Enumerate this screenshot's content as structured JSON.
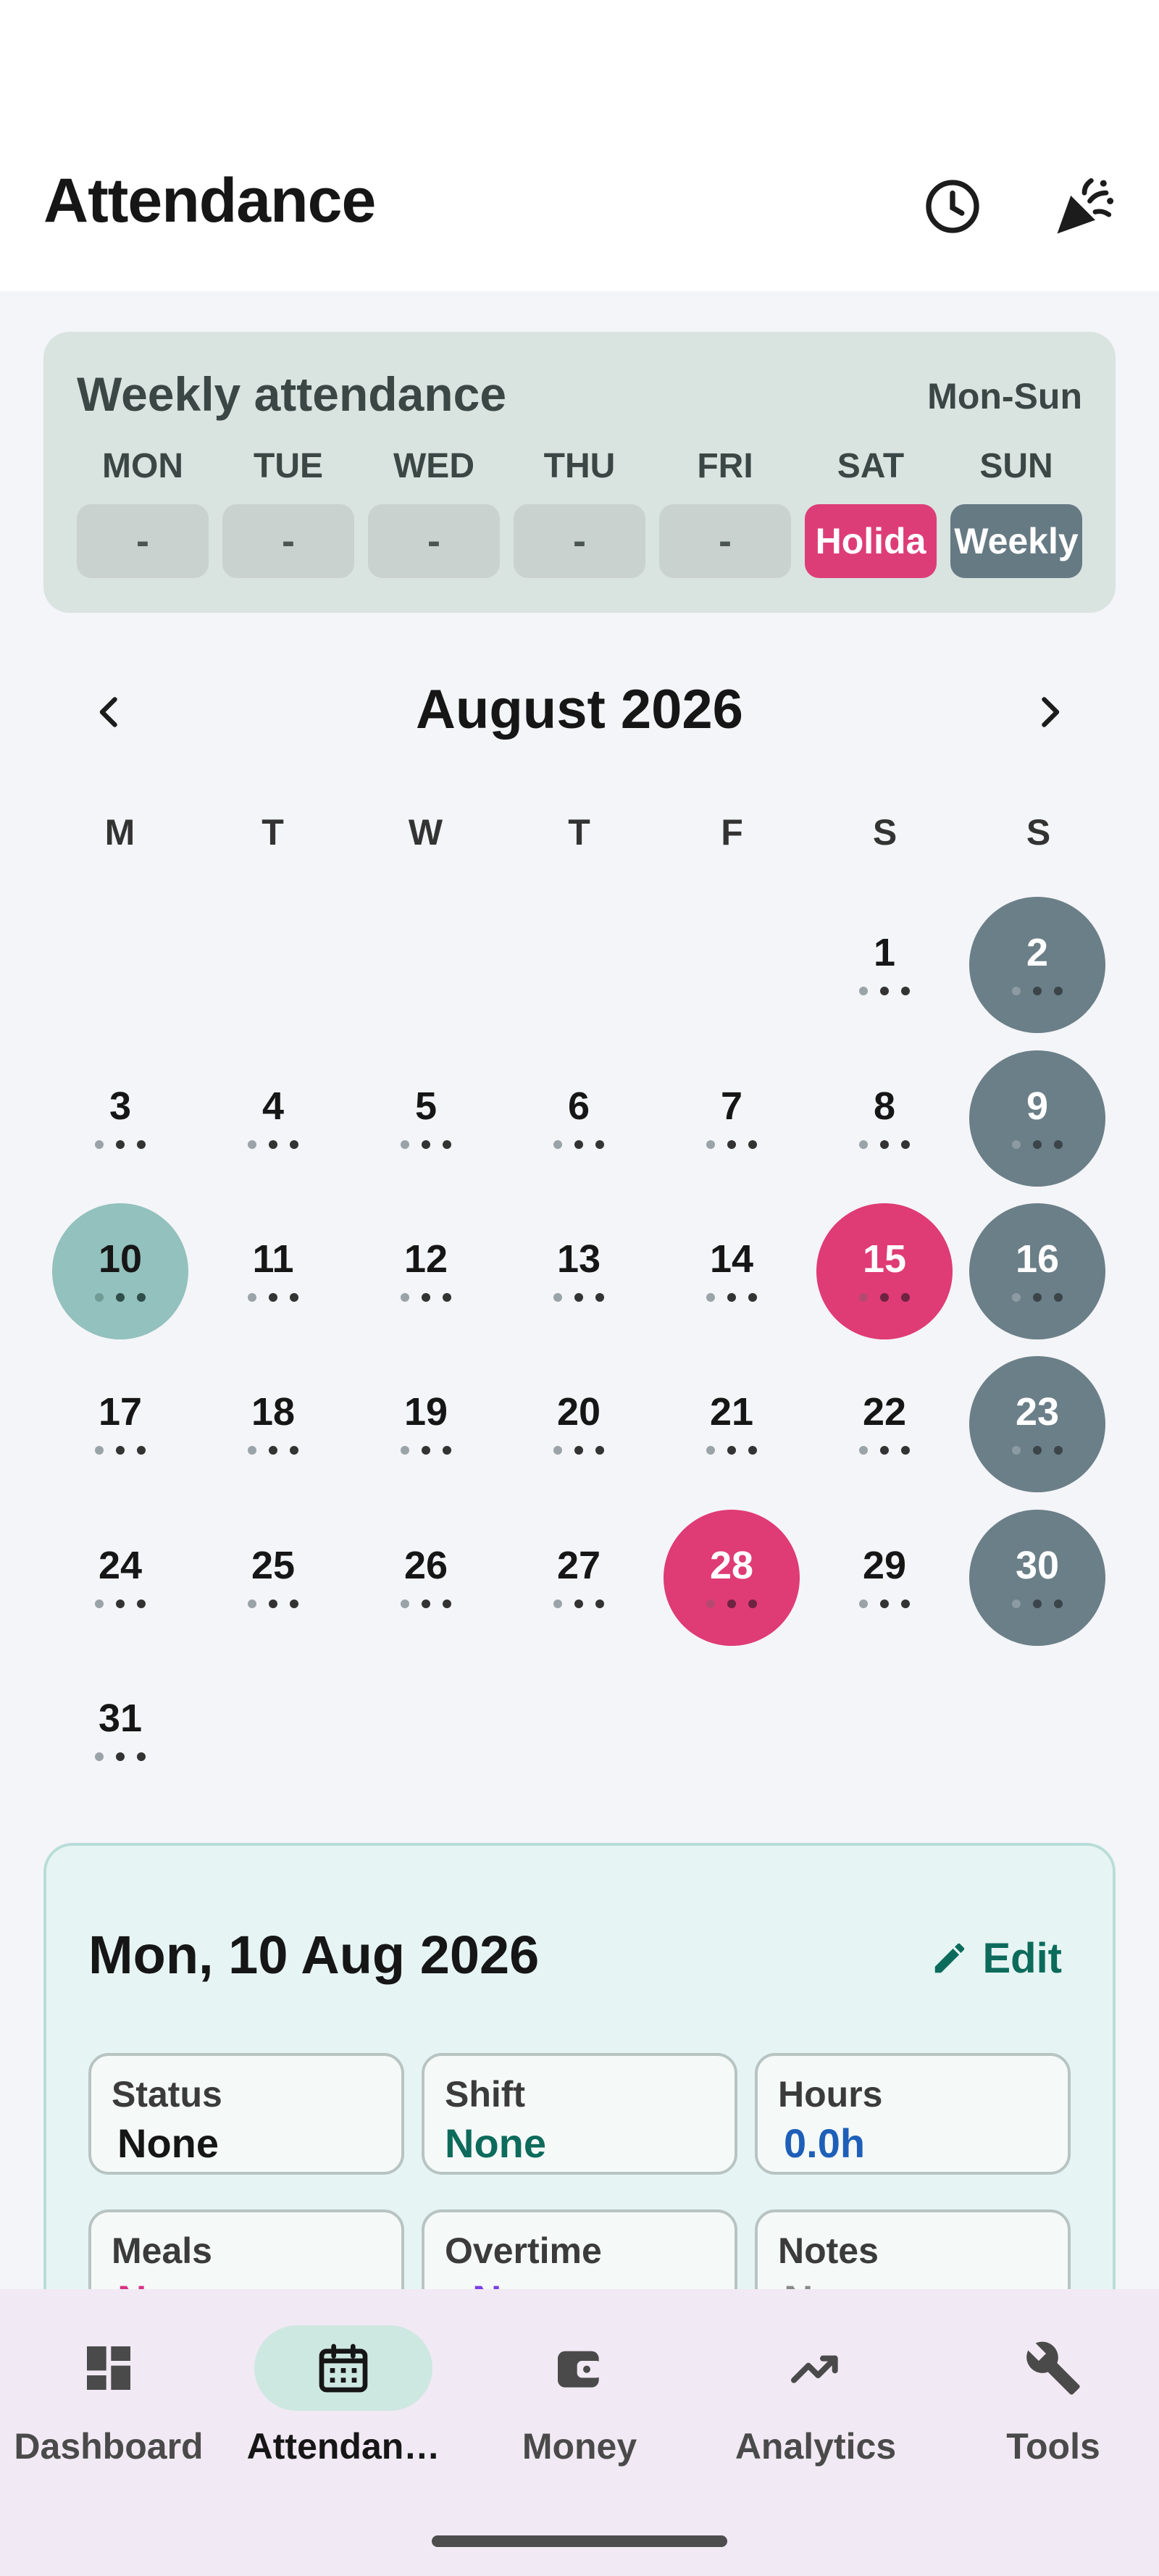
{
  "app": {
    "title": "Attendance"
  },
  "appbar": {
    "icons": [
      "history-clock-icon",
      "celebration-popper-icon"
    ]
  },
  "weekly": {
    "title": "Weekly attendance",
    "range": "Mon-Sun",
    "days": [
      {
        "label": "MON",
        "value": "-",
        "type": "empty"
      },
      {
        "label": "TUE",
        "value": "-",
        "type": "empty"
      },
      {
        "label": "WED",
        "value": "-",
        "type": "empty"
      },
      {
        "label": "THU",
        "value": "-",
        "type": "empty"
      },
      {
        "label": "FRI",
        "value": "-",
        "type": "empty"
      },
      {
        "label": "SAT",
        "value": "Holida",
        "type": "holiday"
      },
      {
        "label": "SUN",
        "value": "Weekly",
        "type": "weekly"
      }
    ]
  },
  "calendar": {
    "month": "August 2026",
    "weekday_headers": [
      "M",
      "T",
      "W",
      "T",
      "F",
      "S",
      "S"
    ],
    "days": [
      "1",
      "2",
      "3",
      "4",
      "5",
      "6",
      "7",
      "8",
      "9",
      "10",
      "11",
      "12",
      "13",
      "14",
      "15",
      "16",
      "17",
      "18",
      "19",
      "20",
      "21",
      "22",
      "23",
      "24",
      "25",
      "26",
      "27",
      "28",
      "29",
      "30",
      "31"
    ],
    "weekly_off_days": [
      "2",
      "9",
      "16",
      "23",
      "30"
    ],
    "holiday_days": [
      "15",
      "28"
    ],
    "selected_day": "10"
  },
  "detail": {
    "date": "Mon, 10 Aug 2026",
    "edit_label": "Edit",
    "fields": {
      "status": {
        "label": "Status",
        "value": "None",
        "color": "#161616"
      },
      "shift": {
        "label": "Shift",
        "value": "None",
        "color": "#0d6b5c"
      },
      "hours": {
        "label": "Hours",
        "value": "0.0h",
        "color": "#1e5fb8"
      },
      "meals": {
        "label": "Meals",
        "value": "None",
        "color": "#d63384"
      },
      "overtime": {
        "label": "Overtime",
        "value": "None",
        "color": "#7b3fe4"
      },
      "notes": {
        "label": "Notes",
        "value": "None",
        "color": "#8a8a8a"
      }
    }
  },
  "nav": {
    "items": [
      {
        "label": "Dashboard",
        "icon": "dashboard-icon"
      },
      {
        "label": "Attendan…",
        "icon": "calendar-icon",
        "active": true
      },
      {
        "label": "Money",
        "icon": "wallet-icon"
      },
      {
        "label": "Analytics",
        "icon": "trending-up-icon"
      },
      {
        "label": "Tools",
        "icon": "wrench-icon"
      }
    ]
  },
  "colors": {
    "accent": "#0d6b5c",
    "holiday": "#df3b74",
    "weekly_off": "#6b7f88",
    "selected": "#93c1bd"
  }
}
